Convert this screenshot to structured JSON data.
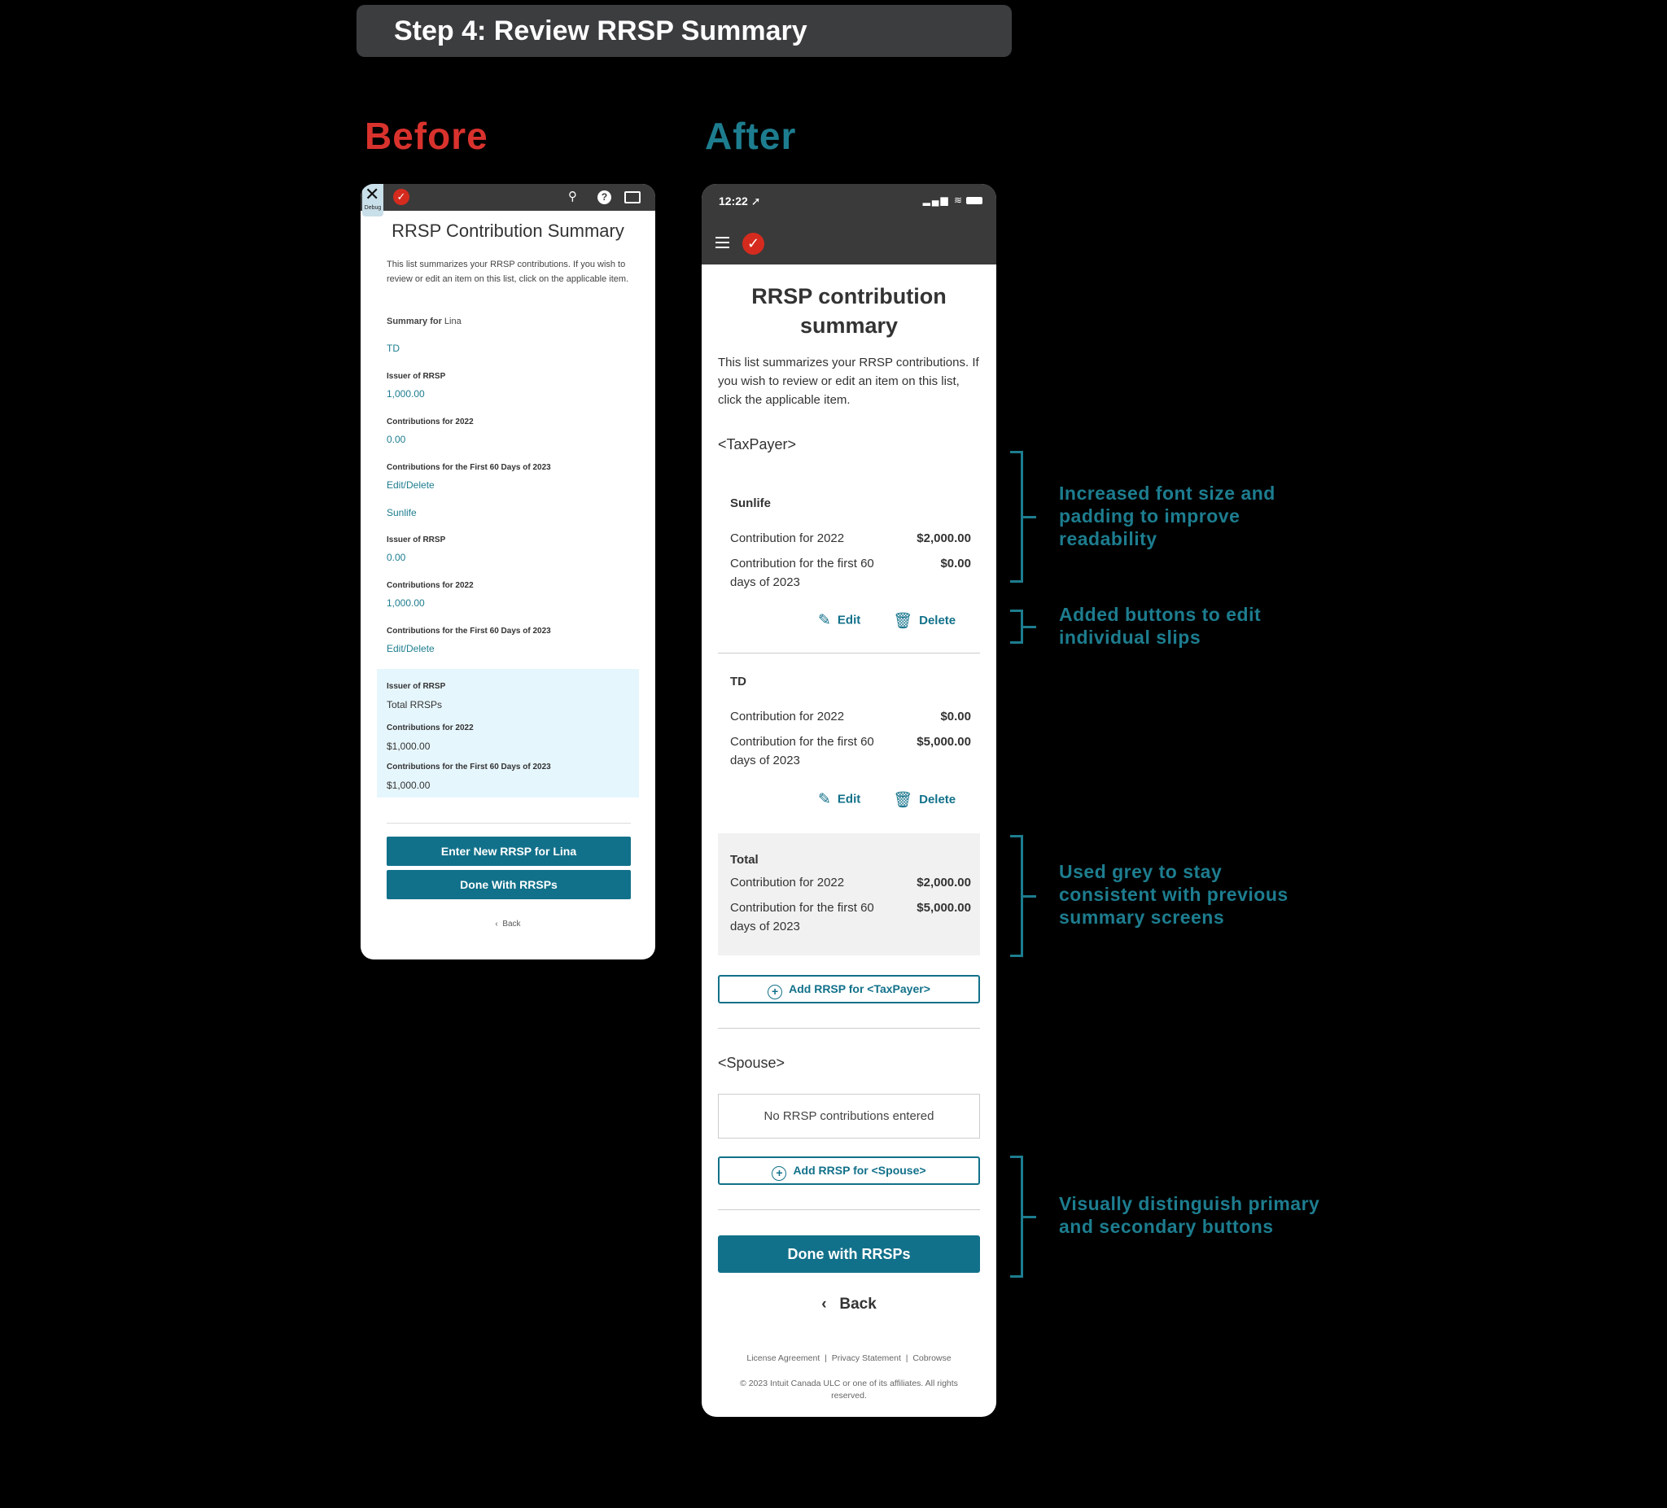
{
  "banner": "Step 4: Review RRSP Summary",
  "before_label": "Before",
  "after_label": "After",
  "before": {
    "debug": "Debug",
    "title": "RRSP Contribution Summary",
    "intro": "This list summarizes your RRSP contributions. If you wish to review or edit an item on this list, click on the applicable item.",
    "summary_prefix": "Summary for",
    "summary_name": "Lina",
    "td": "TD",
    "issuer_label": "Issuer of RRSP",
    "td_issuer_value": "1,000.00",
    "contrib_2022_label": "Contributions for 2022",
    "td_2022_value": "0.00",
    "first60_label": "Contributions for the First 60 Days of 2023",
    "edit_delete": "Edit/Delete",
    "sunlife": "Sunlife",
    "sun_issuer_value": "0.00",
    "sun_2022_value": "1,000.00",
    "total_rrsps": "Total RRSPs",
    "total_2022": "$1,000.00",
    "total_first60": "$1,000.00",
    "btn_enter": "Enter New RRSP for Lina",
    "btn_done": "Done With RRSPs",
    "back": "Back"
  },
  "after": {
    "time": "12:22",
    "title": "RRSP contribution summary",
    "intro": "This list summarizes your RRSP contributions. If you wish to review or edit an item on this list, click the applicable item.",
    "taxpayer": "<TaxPayer>",
    "sunlife": {
      "name": "Sunlife",
      "c2022_label": "Contribution for 2022",
      "c2022_value": "$2,000.00",
      "first60_label": "Contribution for the first 60 days of 2023",
      "first60_value": "$0.00"
    },
    "td": {
      "name": "TD",
      "c2022_label": "Contribution for 2022",
      "c2022_value": "$0.00",
      "first60_label": "Contribution for the first 60 days of 2023",
      "first60_value": "$5,000.00"
    },
    "edit": "Edit",
    "delete": "Delete",
    "total": {
      "name": "Total",
      "c2022_label": "Contribution for 2022",
      "c2022_value": "$2,000.00",
      "first60_label": "Contribution for the first 60 days of 2023",
      "first60_value": "$5,000.00"
    },
    "add_taxpayer": "Add RRSP for <TaxPayer>",
    "spouse": "<Spouse>",
    "no_contrib": "No RRSP contributions entered",
    "add_spouse": "Add RRSP for <Spouse>",
    "done": "Done with RRSPs",
    "back": "Back",
    "footer_links": [
      "License Agreement",
      "Privacy Statement",
      "Cobrowse"
    ],
    "footer_sep": "|",
    "copyright": "© 2023 Intuit Canada ULC or one of its affiliates. All rights reserved."
  },
  "notes": [
    "Increased font size and padding to improve readability",
    "Added buttons to edit individual slips",
    "Used grey to stay consistent with previous summary screens",
    "Visually distinguish primary and secondary buttons"
  ],
  "colors": {
    "accent": "#12718a",
    "annotation": "#1d7d8f",
    "before_red": "#d9322d",
    "brand_red": "#d52b1e",
    "total_bg_before": "#e6f6fd",
    "total_bg_after": "#f1f1f1"
  }
}
